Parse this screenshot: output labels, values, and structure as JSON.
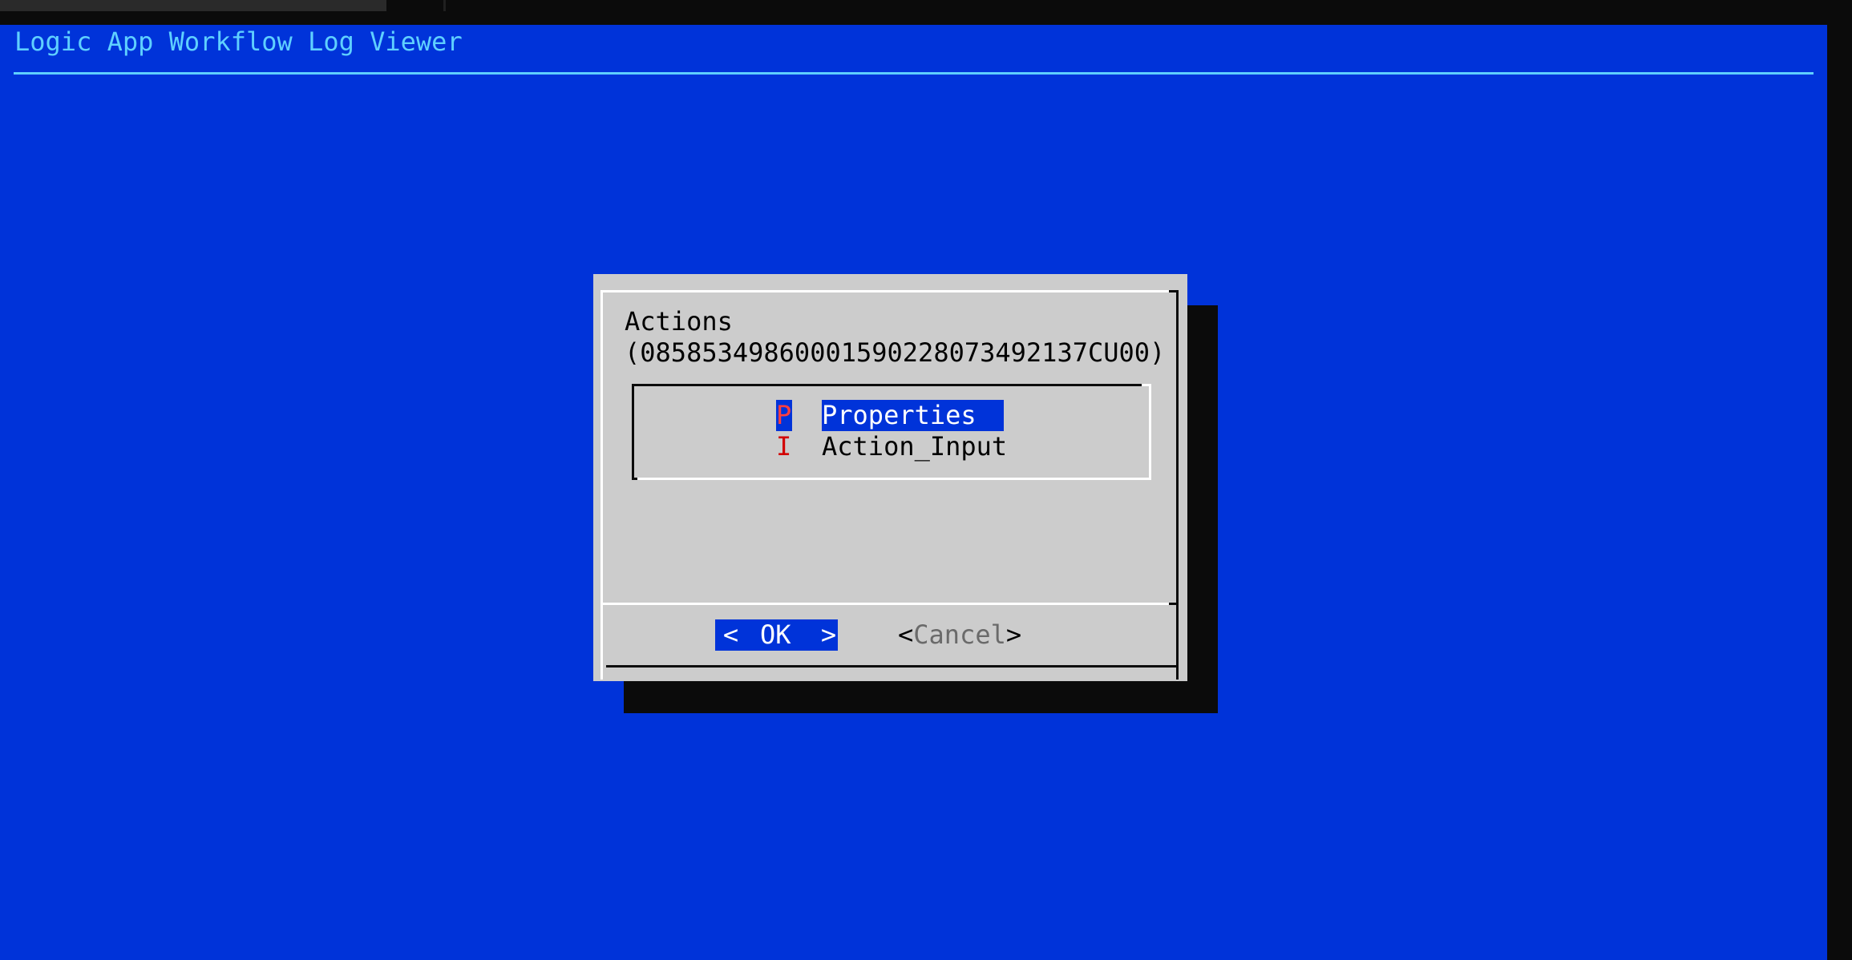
{
  "app": {
    "backtitle": "Logic App Workflow Log Viewer"
  },
  "dialog": {
    "title_line1": "Actions",
    "title_line2": "(08585349860001590228073492137CU00)",
    "menu_items": [
      {
        "hotkey": "P",
        "label": "Properties",
        "selected": true
      },
      {
        "hotkey": "I",
        "label": "Action_Input",
        "selected": false
      }
    ],
    "buttons": {
      "ok": {
        "left": "<",
        "label": "OK",
        "right": ">"
      },
      "cancel": {
        "left": "<",
        "label": "Cancel",
        "right": ">"
      }
    }
  },
  "colors": {
    "screen_background": "#0033d9",
    "dialog_background": "#cccccc",
    "backtitle_text": "#5fd0ff",
    "hotkey": "#d20000",
    "selection": "#0033d9",
    "shadow": "#0b0b0b"
  }
}
